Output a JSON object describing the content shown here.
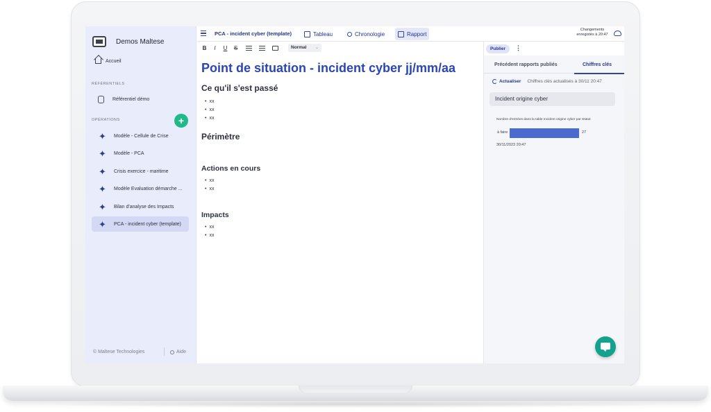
{
  "sidebar": {
    "workspace_name": "Demos Maltese",
    "home_label": "Accueil",
    "referentiels_title": "RÉFÉRENTIELS",
    "referentiel_item": "Référentiel démo",
    "operations_title": "OPÉRATIONS",
    "add_label": "+",
    "operations": [
      {
        "label": "Modèle - Cellule de Crise",
        "active": false
      },
      {
        "label": "Modèle - PCA",
        "active": false
      },
      {
        "label": "Crisis exercice - maritime",
        "active": false
      },
      {
        "label": "Modèle Evaluation démarche ...",
        "active": false
      },
      {
        "label": "Bilan d'analyse des Impacts",
        "active": false
      },
      {
        "label": "PCA - incident cyber (template)",
        "active": true
      }
    ],
    "footer_copyright": "© Maltese Technologies",
    "footer_help": "Aide"
  },
  "topbar": {
    "document_title": "PCA - incident cyber (template)",
    "tabs": [
      {
        "label": "Tableau",
        "icon": "table-icon"
      },
      {
        "label": "Chronologie",
        "icon": "timeline-icon"
      },
      {
        "label": "Rapport",
        "icon": "report-icon",
        "active": true
      }
    ],
    "save_status_line1": "Changements",
    "save_status_line2": "enregistés à 20:47"
  },
  "editor": {
    "toolbar": {
      "bold": "B",
      "italic": "I",
      "underline": "U",
      "strike": "S",
      "style_value": "Normal"
    },
    "title": "Point de situation - incident cyber jj/mm/aa",
    "sections": [
      {
        "heading": "Ce qu'il s'est passé",
        "items": [
          "xx",
          "xx",
          "xx"
        ]
      },
      {
        "heading": "Périmètre",
        "items": []
      },
      {
        "heading": "Actions en cours",
        "items": [
          "xx",
          "xx"
        ]
      },
      {
        "heading": "Impacts",
        "items": [
          "xx",
          "xx"
        ]
      }
    ]
  },
  "panel": {
    "publish_label": "Publier",
    "kebab_label": "⋮",
    "tabs": [
      {
        "label": "Précédent rapports publiés",
        "active": false
      },
      {
        "label": "Chiffres clés",
        "active": true
      }
    ],
    "refresh_label": "Actualiser",
    "refresh_note": "Chiffres clés actualisés à 30/11 20:47",
    "kpi_title": "Incident origine cyber",
    "kpi_chart_title": "Nombre d'entrées dans la table Incident origine cyber par Statut",
    "kpi_date": "30/11/2023 20:47"
  },
  "chart_data": {
    "type": "bar",
    "orientation": "horizontal",
    "title": "Nombre d'entrées dans la table Incident origine cyber par Statut",
    "categories": [
      "à faire"
    ],
    "values": [
      27
    ],
    "xlim": [
      0,
      27
    ]
  },
  "colors": {
    "accent": "#2a46b4",
    "sidebar_bg": "#e9ecfb",
    "add_button": "#1fb98a",
    "chat_button": "#14a28e",
    "bar": "#4b6bd1"
  }
}
